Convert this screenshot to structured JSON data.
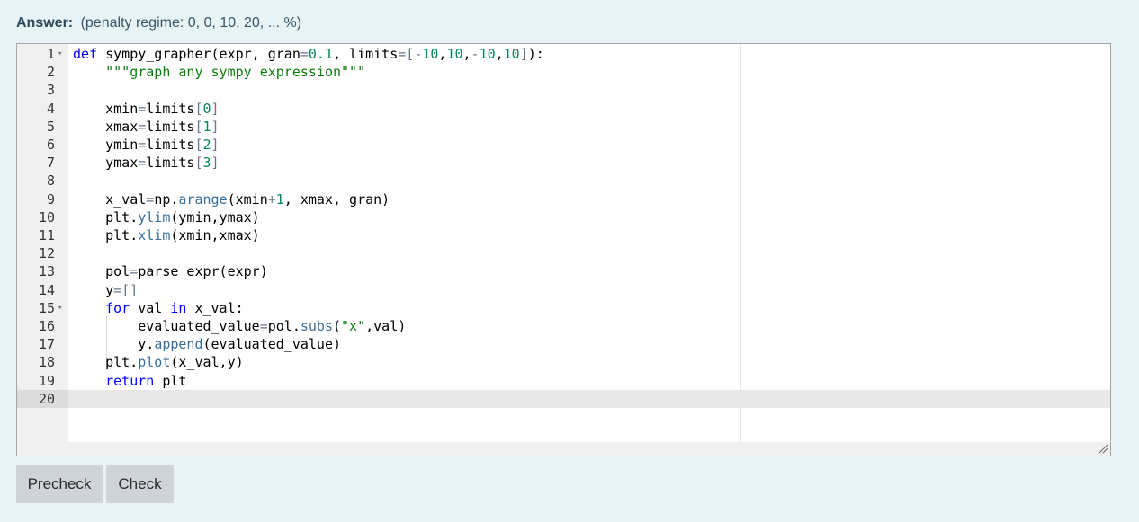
{
  "answer": {
    "label": "Answer:",
    "penalty": "(penalty regime: 0, 0, 10, 20, ... %)"
  },
  "editor": {
    "lines": [
      {
        "n": "1",
        "fold": true
      },
      {
        "n": "2"
      },
      {
        "n": "3"
      },
      {
        "n": "4"
      },
      {
        "n": "5"
      },
      {
        "n": "6"
      },
      {
        "n": "7"
      },
      {
        "n": "8"
      },
      {
        "n": "9"
      },
      {
        "n": "10"
      },
      {
        "n": "11"
      },
      {
        "n": "12"
      },
      {
        "n": "13"
      },
      {
        "n": "14"
      },
      {
        "n": "15",
        "fold": true
      },
      {
        "n": "16"
      },
      {
        "n": "17"
      },
      {
        "n": "18"
      },
      {
        "n": "19"
      },
      {
        "n": "20"
      }
    ],
    "code": [
      "def sympy_grapher(expr, gran=0.1, limits=[-10,10,-10,10]):",
      "    \"\"\"graph any sympy expression\"\"\"",
      "",
      "    xmin=limits[0]",
      "    xmax=limits[1]",
      "    ymin=limits[2]",
      "    ymax=limits[3]",
      "",
      "    x_val=np.arange(xmin+1, xmax, gran)",
      "    plt.ylim(ymin,ymax)",
      "    plt.xlim(xmin,xmax)",
      "",
      "    pol=parse_expr(expr)",
      "    y=[]",
      "    for val in x_val:",
      "        evaluated_value=pol.subs(\"x\",val)",
      "        y.append(evaluated_value)",
      "    plt.plot(x_val,y)",
      "    return plt",
      ""
    ],
    "active_line": 20
  },
  "buttons": {
    "precheck": "Precheck",
    "check": "Check"
  },
  "icons": {
    "fold": "fold-arrow-icon",
    "resize": "resize-handle-icon"
  }
}
